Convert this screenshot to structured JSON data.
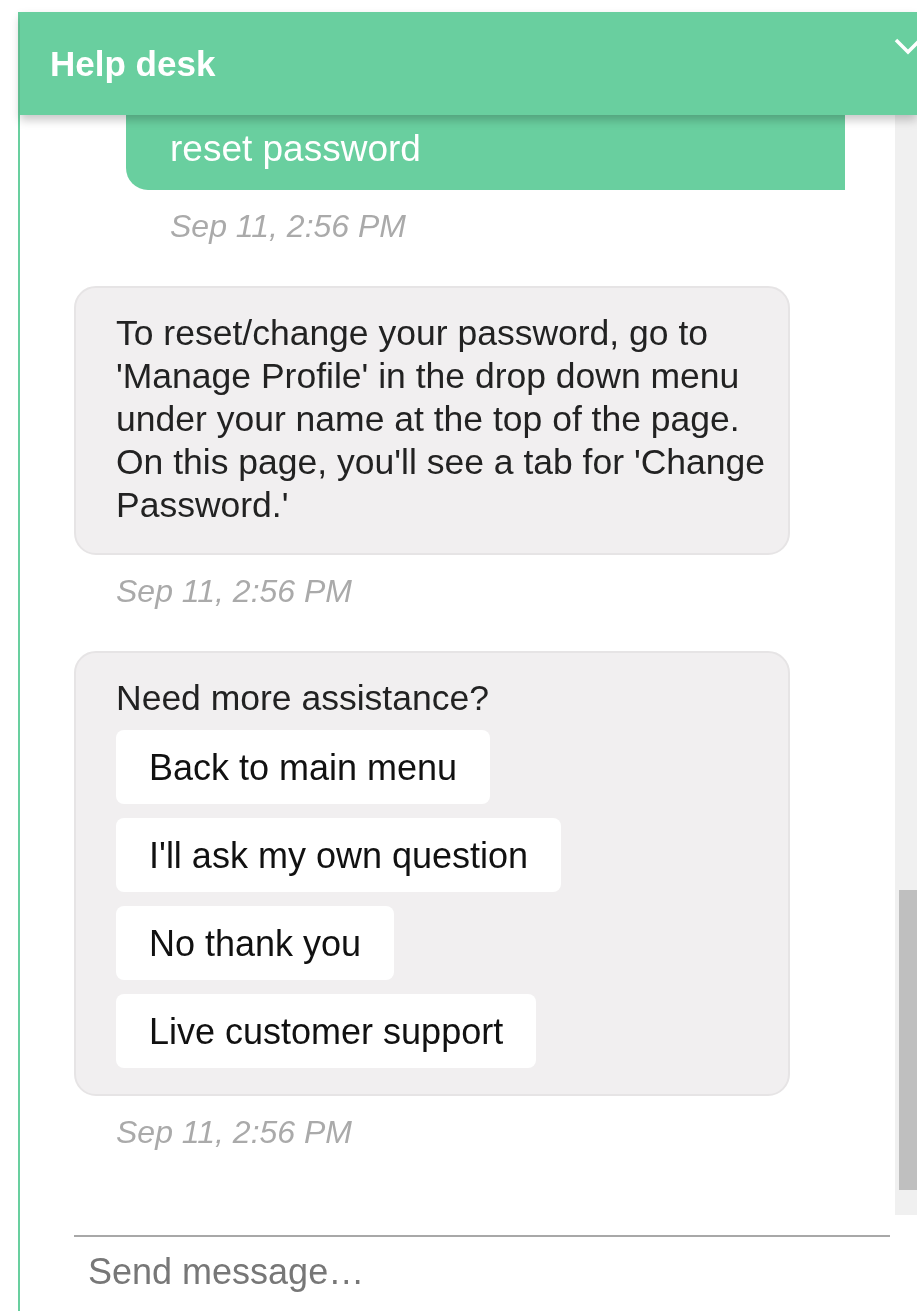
{
  "header": {
    "title": "Help desk"
  },
  "messages": [
    {
      "kind": "user",
      "text": "reset password",
      "time": "Sep 11, 2:56 PM"
    },
    {
      "kind": "bot",
      "text": "To reset/change your password, go to 'Manage Profile' in the drop down menu under your name at the top of the page. On this page, you'll see a tab for 'Change Password.'",
      "time": "Sep 11, 2:56 PM"
    },
    {
      "kind": "bot",
      "text": "Need more assistance?",
      "options": [
        "Back to main menu",
        "I'll ask my own question",
        "No thank you",
        "Live customer support"
      ],
      "time": "Sep 11, 2:56 PM"
    }
  ],
  "composer": {
    "placeholder": "Send message…"
  }
}
